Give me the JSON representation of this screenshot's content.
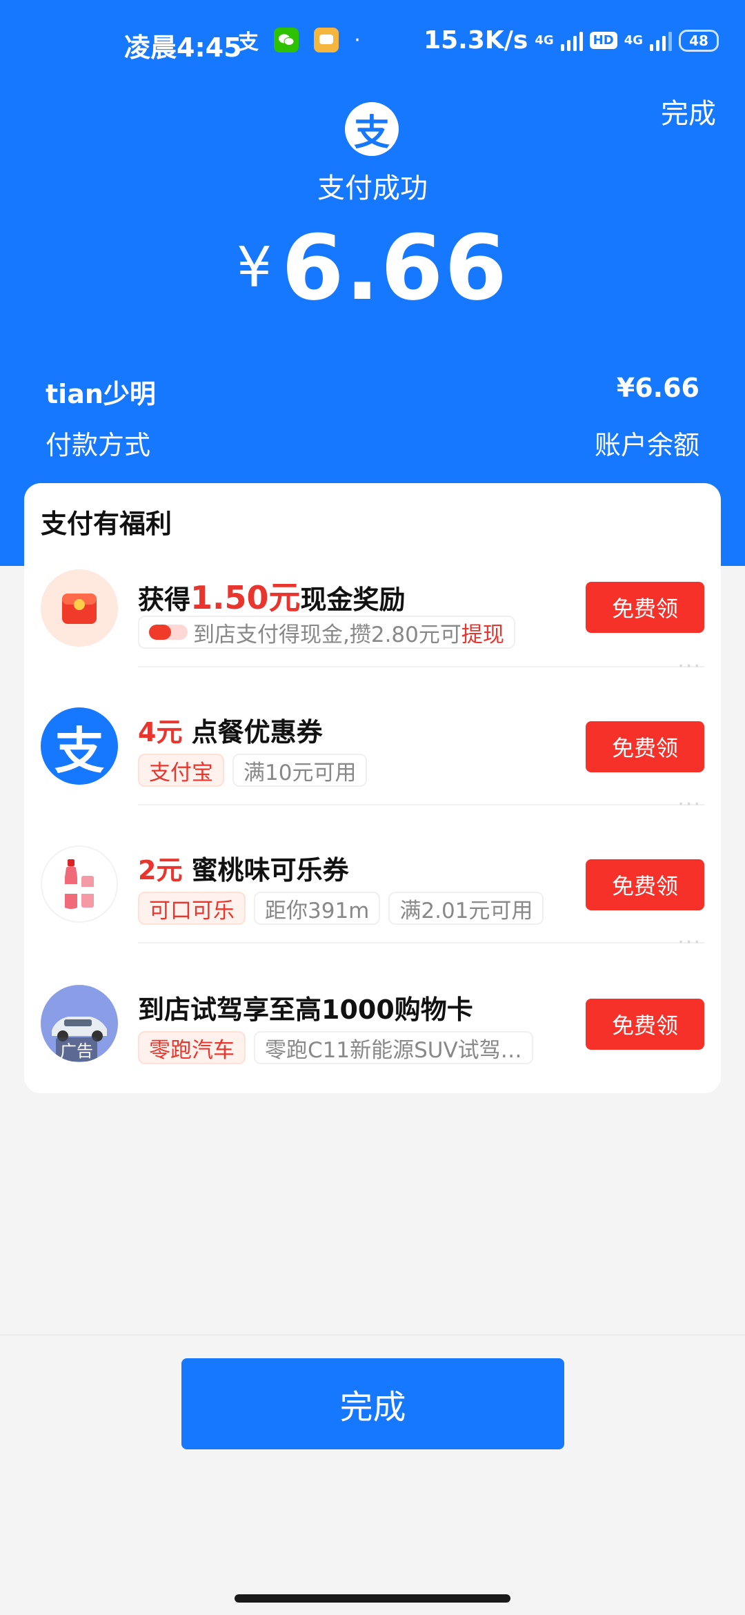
{
  "status_bar": {
    "time": "凌晨4:45",
    "network_speed": "15.3K/s",
    "net1": "4G",
    "net2": "4G",
    "hd": "HD",
    "battery": "48"
  },
  "header": {
    "top_done": "完成",
    "logo_glyph": "支",
    "status": "支付成功",
    "currency": "¥",
    "amount": "6.66"
  },
  "payment_info": {
    "payee": "tian少明",
    "amount": "¥6.66",
    "method_label": "付款方式",
    "method_value": "账户余额"
  },
  "benefits": {
    "title": "支付有福利",
    "items": [
      {
        "title_prefix": "获得",
        "title_highlight": "1.50元",
        "title_suffix": "现金奖励",
        "tag_text": "到店支付得现金,攒2.80元可",
        "tag_highlight": "提现",
        "button": "免费领",
        "icon": "red-packet-icon"
      },
      {
        "title_highlight": "4元",
        "title_suffix": " 点餐优惠券",
        "tags": [
          "支付宝",
          "满10元可用"
        ],
        "button": "免费领",
        "icon": "alipay-logo-icon",
        "icon_glyph": "支"
      },
      {
        "title_highlight": "2元",
        "title_suffix": " 蜜桃味可乐券",
        "tags": [
          "可口可乐",
          "距你391m",
          "满2.01元可用"
        ],
        "button": "免费领",
        "icon": "cola-bottle-icon"
      },
      {
        "title_suffix": "到店试驾享至高1000购物卡",
        "tags": [
          "零跑汽车",
          "零跑C11新能源SUV试驾…"
        ],
        "button": "免费领",
        "icon": "car-icon",
        "ad_label": "广告"
      }
    ],
    "more": "···"
  },
  "footer": {
    "done": "完成"
  },
  "colors": {
    "brand_blue": "#1677ff",
    "accent_red": "#f5312a"
  }
}
